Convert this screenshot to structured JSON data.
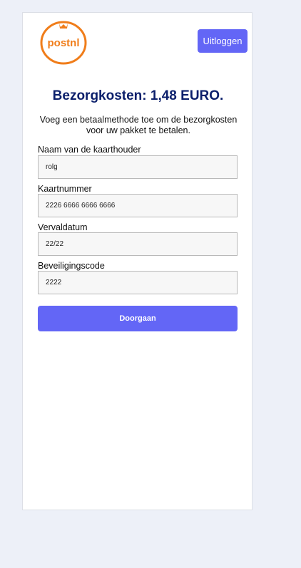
{
  "header": {
    "logo_text": "postnl",
    "logout_label": "Uitloggen"
  },
  "main": {
    "title": "Bezorgkosten: 1,48 EURO.",
    "subtitle": "Voeg een betaalmethode toe om de bezorgkosten voor uw pakket te betalen.",
    "fields": [
      {
        "label": "Naam van de kaarthouder",
        "value": "rolg"
      },
      {
        "label": "Kaartnummer",
        "value": "2226 6666 6666 6666"
      },
      {
        "label": "Vervaldatum",
        "value": "22/22"
      },
      {
        "label": "Beveiligingscode",
        "value": "2222"
      }
    ],
    "submit_label": "Doorgaan"
  },
  "colors": {
    "accent": "#6366f6",
    "title": "#0b1f6b",
    "brand_orange": "#f07d1a",
    "page_background": "#edf0f8"
  }
}
